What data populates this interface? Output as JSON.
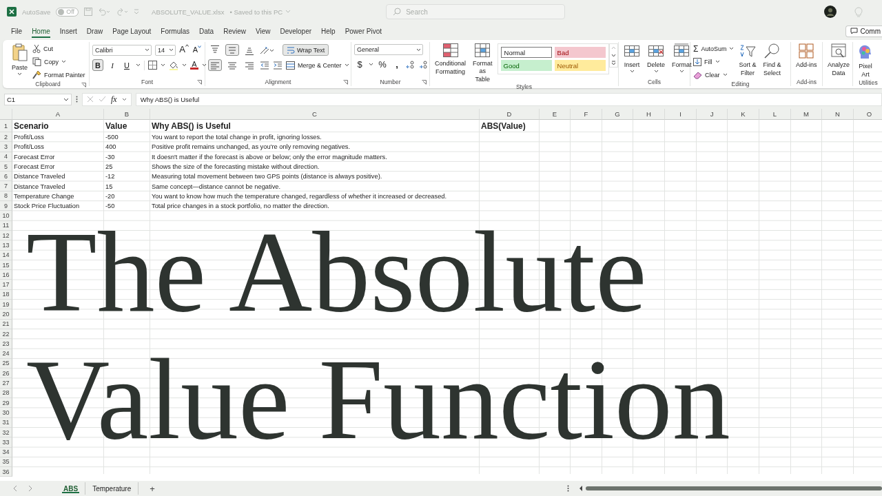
{
  "titlebar": {
    "autosave_label": "AutoSave",
    "autosave": {
      "label": "Off",
      "on": false
    },
    "filename": "ABSOLUTE_VALUE.xlsx",
    "save_status": "• Saved to this PC",
    "search_placeholder": "Search"
  },
  "menu_tabs": [
    {
      "label": "File",
      "selected": false
    },
    {
      "label": "Home",
      "selected": true
    },
    {
      "label": "Insert",
      "selected": false
    },
    {
      "label": "Draw",
      "selected": false
    },
    {
      "label": "Page Layout",
      "selected": false
    },
    {
      "label": "Formulas",
      "selected": false
    },
    {
      "label": "Data",
      "selected": false
    },
    {
      "label": "Review",
      "selected": false
    },
    {
      "label": "View",
      "selected": false
    },
    {
      "label": "Developer",
      "selected": false
    },
    {
      "label": "Help",
      "selected": false
    },
    {
      "label": "Power Pivot",
      "selected": false
    }
  ],
  "comments_button": "Comm",
  "ribbon": {
    "clipboard": {
      "label": "Clipboard",
      "paste": "Paste",
      "cut": "Cut",
      "copy": "Copy",
      "format_painter": "Format Painter"
    },
    "font": {
      "label": "Font",
      "name": "Calibri",
      "size": "14",
      "grow": "A",
      "shrink": "A",
      "format_buttons": [
        {
          "label": "B",
          "on": true
        },
        {
          "label": "I",
          "on": false
        },
        {
          "label": "U",
          "on": false
        }
      ],
      "font_color": "A"
    },
    "alignment": {
      "label": "Alignment",
      "vertical": [
        {
          "kind": "top",
          "on": false
        },
        {
          "kind": "middle",
          "on": true
        },
        {
          "kind": "bottom",
          "on": false
        }
      ],
      "horizontal": [
        {
          "kind": "left",
          "on": true
        },
        {
          "kind": "center",
          "on": false
        },
        {
          "kind": "right",
          "on": false
        }
      ],
      "wrap_text": {
        "label": "Wrap Text",
        "on": true
      },
      "merge": "Merge & Center"
    },
    "number": {
      "label": "Number",
      "format": "General",
      "currency": "$",
      "percent": "%",
      "comma": ","
    },
    "styles": {
      "label": "Styles",
      "conditional": [
        "Conditional",
        "Formatting"
      ],
      "format_table": [
        "Format as",
        "Table"
      ],
      "gallery": [
        {
          "label": "Normal",
          "color": "#ffffff"
        },
        {
          "label": "Bad",
          "color": "#f4c7ce"
        },
        {
          "label": "Good",
          "color": "#c6efce"
        },
        {
          "label": "Neutral",
          "color": "#ffeb9c"
        }
      ]
    },
    "cells": {
      "label": "Cells",
      "buttons": [
        "Insert",
        "Delete",
        "Format"
      ]
    },
    "editing": {
      "label": "Editing",
      "autosum_symbol": "Σ",
      "autosum": "AutoSum",
      "fill": "Fill",
      "clear": "Clear",
      "sort": [
        "Sort &",
        "Filter"
      ],
      "find": [
        "Find &",
        "Select"
      ]
    },
    "addins": {
      "label": "Add-ins",
      "button": "Add-ins"
    },
    "analyze": {
      "button": [
        "Analyze",
        "Data"
      ]
    },
    "utilities": {
      "label": "Utilities",
      "button": [
        "Pixel",
        "Art"
      ]
    }
  },
  "formula_bar": {
    "name_box": "C1",
    "fx": "fx",
    "content": "Why ABS() is Useful"
  },
  "sheet": {
    "columns": [
      "A",
      "B",
      "C",
      "D",
      "E",
      "F",
      "G",
      "H",
      "I",
      "J",
      "K",
      "L",
      "M",
      "N",
      "O"
    ],
    "rows": [
      {
        "number": "1",
        "cells": [
          "Scenario",
          "Value",
          "Why ABS() is Useful",
          "ABS(Value)"
        ]
      },
      {
        "number": "2",
        "cells": [
          "Profit/Loss",
          "-500",
          "You want to report the total change in profit, ignoring losses."
        ]
      },
      {
        "number": "3",
        "cells": [
          "Profit/Loss",
          "400",
          "Positive profit remains unchanged, as you're only removing negatives."
        ]
      },
      {
        "number": "4",
        "cells": [
          "Forecast Error",
          "-30",
          "It doesn't matter if the forecast is above or below; only the error magnitude matters."
        ]
      },
      {
        "number": "5",
        "cells": [
          "Forecast Error",
          "25",
          "Shows the size of the forecasting mistake without direction."
        ]
      },
      {
        "number": "6",
        "cells": [
          "Distance Traveled",
          "-12",
          "Measuring total movement between two GPS points (distance is always positive)."
        ]
      },
      {
        "number": "7",
        "cells": [
          "Distance Traveled",
          "15",
          "Same concept—distance cannot be negative."
        ]
      },
      {
        "number": "8",
        "cells": [
          "Temperature Change",
          "-20",
          "You want to know how much the temperature changed, regardless of whether it increased or decreased."
        ]
      },
      {
        "number": "9",
        "cells": [
          "Stock Price Fluctuation",
          "-50",
          "Total price changes in a stock portfolio, no matter the direction."
        ]
      },
      {
        "number": "10"
      },
      {
        "number": "11"
      },
      {
        "number": "12"
      },
      {
        "number": "13"
      },
      {
        "number": "14"
      },
      {
        "number": "15"
      },
      {
        "number": "16"
      },
      {
        "number": "17"
      },
      {
        "number": "18"
      },
      {
        "number": "19"
      },
      {
        "number": "20"
      },
      {
        "number": "21"
      },
      {
        "number": "22"
      },
      {
        "number": "23"
      },
      {
        "number": "24"
      },
      {
        "number": "25"
      },
      {
        "number": "26"
      },
      {
        "number": "27"
      },
      {
        "number": "28"
      },
      {
        "number": "29"
      },
      {
        "number": "30"
      },
      {
        "number": "31"
      },
      {
        "number": "32"
      },
      {
        "number": "33"
      },
      {
        "number": "34"
      },
      {
        "number": "35"
      },
      {
        "number": "36"
      }
    ]
  },
  "overlay_title": [
    "The Absolute",
    "Value Function"
  ],
  "sheet_tabs": [
    {
      "label": "ABS",
      "selected": true
    },
    {
      "label": "Temperature",
      "selected": false
    }
  ],
  "add_sheet": "+"
}
